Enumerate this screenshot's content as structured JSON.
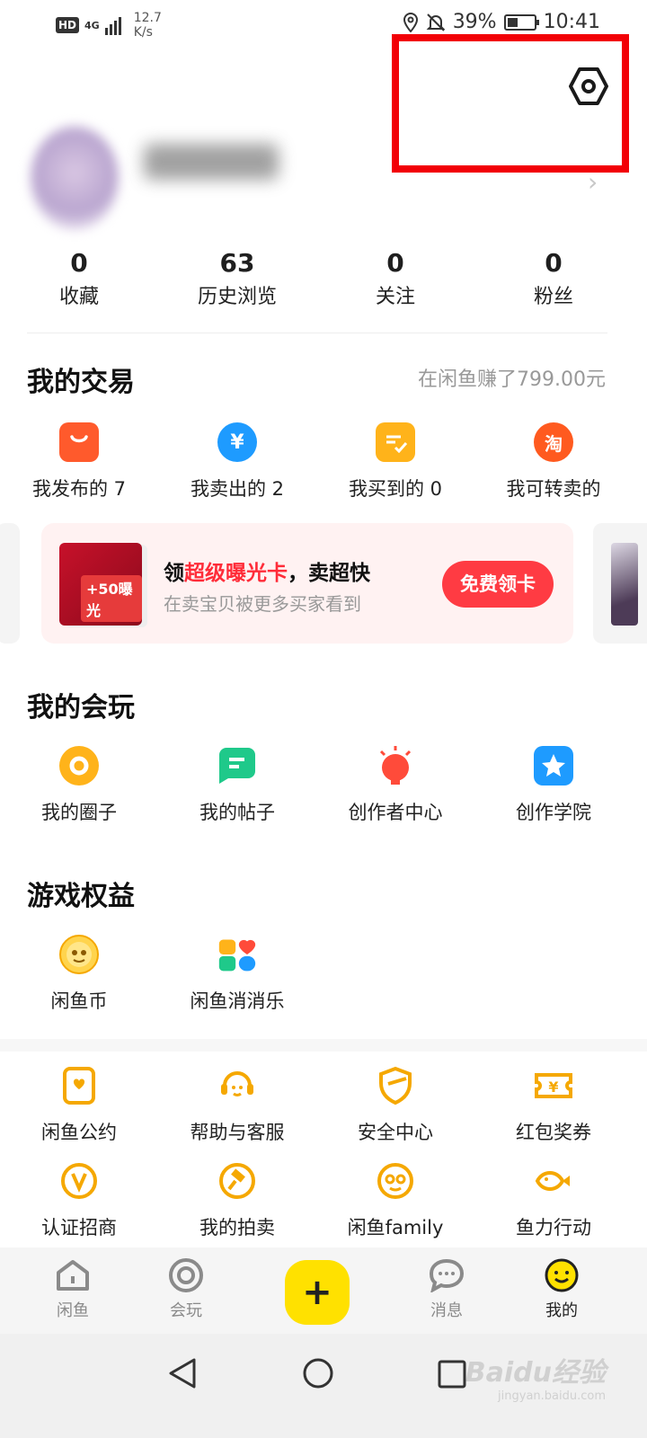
{
  "status_bar": {
    "hd": "HD",
    "network": "4G",
    "speed_value": "12.7",
    "speed_unit": "K/s",
    "battery": "39%",
    "battery_level": 0.39,
    "time": "10:41"
  },
  "header": {
    "settings_icon": "gear-hexagon-icon",
    "highlight_color": "#f20006"
  },
  "stats": [
    {
      "value": "0",
      "label": "收藏"
    },
    {
      "value": "63",
      "label": "历史浏览"
    },
    {
      "value": "0",
      "label": "关注"
    },
    {
      "value": "0",
      "label": "粉丝"
    }
  ],
  "trade": {
    "title": "我的交易",
    "earned": "在闲鱼赚了799.00元",
    "items": [
      {
        "label": "我发布的 7",
        "icon": "bag-icon",
        "color": "#ff5a2c"
      },
      {
        "label": "我卖出的 2",
        "icon": "yen-icon",
        "color": "#1e9bff"
      },
      {
        "label": "我买到的 0",
        "icon": "receipt-check-icon",
        "color": "#ffb31a"
      },
      {
        "label": "我可转卖的",
        "icon": "taobao-icon",
        "color": "#ff5a1f",
        "glyph": "淘"
      }
    ]
  },
  "banner": {
    "tag": "+50曝光",
    "title_prefix": "领",
    "title_highlight": "超级曝光卡",
    "title_suffix": "，卖超快",
    "subtitle": "在卖宝贝被更多买家看到",
    "button": "免费领卡"
  },
  "play": {
    "title": "我的会玩",
    "items": [
      {
        "label": "我的圈子",
        "icon": "circle-ring-icon",
        "color": "#ffb31a"
      },
      {
        "label": "我的帖子",
        "icon": "post-icon",
        "color": "#1fc98a"
      },
      {
        "label": "创作者中心",
        "icon": "bulb-icon",
        "color": "#ff4b3a"
      },
      {
        "label": "创作学院",
        "icon": "star-icon",
        "color": "#1e9bff"
      }
    ]
  },
  "games": {
    "title": "游戏权益",
    "items": [
      {
        "label": "闲鱼币",
        "icon": "fish-coin-icon"
      },
      {
        "label": "闲鱼消消乐",
        "icon": "match-game-icon"
      }
    ]
  },
  "services": {
    "row1": [
      {
        "label": "闲鱼公约",
        "icon": "convention-icon"
      },
      {
        "label": "帮助与客服",
        "icon": "headset-icon"
      },
      {
        "label": "安全中心",
        "icon": "shield-icon"
      },
      {
        "label": "红包奖券",
        "icon": "coupon-icon"
      }
    ],
    "row2": [
      {
        "label": "认证招商",
        "icon": "verified-v-icon"
      },
      {
        "label": "我的拍卖",
        "icon": "gavel-icon"
      },
      {
        "label": "闲鱼family",
        "icon": "family-face-icon"
      },
      {
        "label": "鱼力行动",
        "icon": "fish-icon"
      }
    ],
    "accent": "#f5a800"
  },
  "bottom_nav": {
    "items": [
      {
        "label": "闲鱼",
        "icon": "home-icon"
      },
      {
        "label": "会玩",
        "icon": "target-icon"
      },
      {
        "label": "消息",
        "icon": "chat-icon"
      },
      {
        "label": "我的",
        "icon": "smile-face-icon"
      }
    ],
    "publish": "+",
    "active": "我的"
  },
  "watermark": {
    "brand": "Baidu经验",
    "url": "jingyan.baidu.com"
  }
}
